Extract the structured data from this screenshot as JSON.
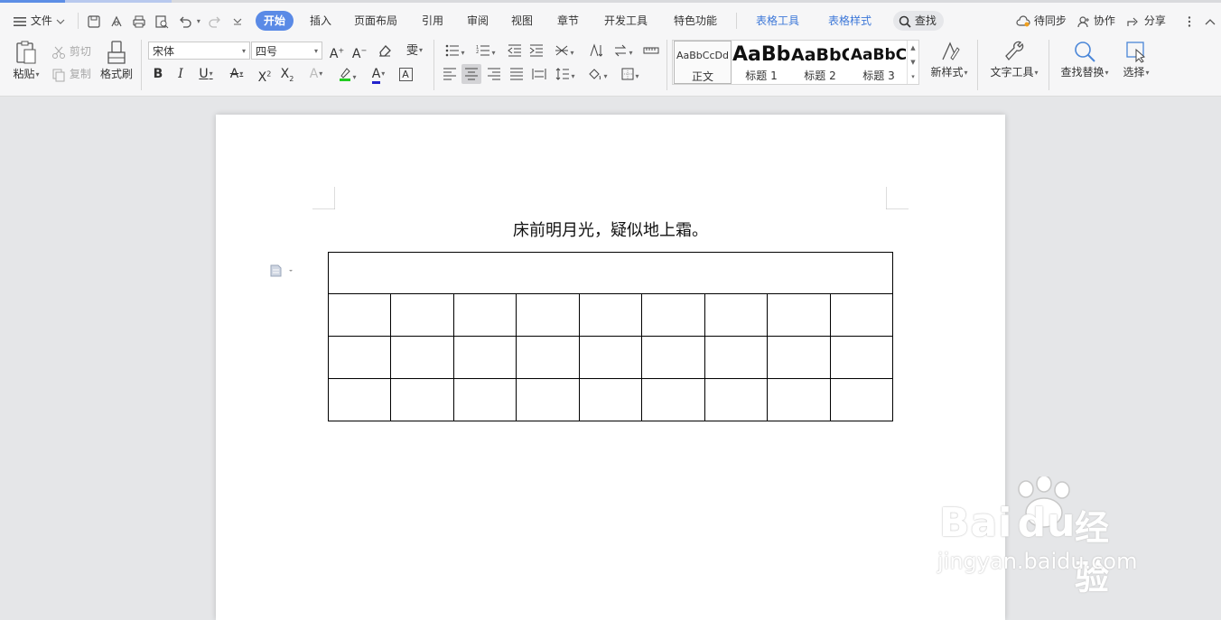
{
  "menu": {
    "file": "文件",
    "tabs": [
      "开始",
      "插入",
      "页面布局",
      "引用",
      "审阅",
      "视图",
      "章节",
      "开发工具",
      "特色功能"
    ],
    "context_tabs": [
      "表格工具",
      "表格样式"
    ],
    "search": "查找",
    "sync": "待同步",
    "collab": "协作",
    "share": "分享"
  },
  "clipboard": {
    "paste": "粘贴",
    "cut": "剪切",
    "copy": "复制",
    "format_painter": "格式刷"
  },
  "font": {
    "name": "宋体",
    "size": "四号"
  },
  "styles": [
    {
      "sample": "AaBbCcDd",
      "name": "正文"
    },
    {
      "sample": "AaBb",
      "name": "标题 1"
    },
    {
      "sample": "AaBbC",
      "name": "标题 2"
    },
    {
      "sample": "AaBbC",
      "name": "标题 3"
    }
  ],
  "tools": {
    "new_style": "新样式",
    "text_tools": "文字工具",
    "find_replace": "查找替换",
    "select": "选择"
  },
  "document": {
    "title": "床前明月光，疑似地上霜。",
    "table": {
      "rows": 4,
      "cols": 9,
      "first_row_merged": true
    }
  },
  "watermark": {
    "brand": "Bai",
    "brand_cn": "经验",
    "url": "jingyan.baidu.com"
  },
  "colors": {
    "accent": "#5a8ae6",
    "context_tab": "#3d78d8",
    "highlight": "#22cc22",
    "font_color": "#2222cc"
  }
}
